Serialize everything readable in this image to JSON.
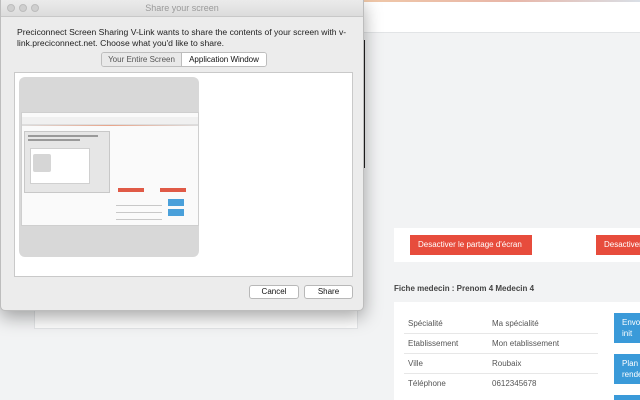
{
  "dialog": {
    "title": "Share your screen",
    "message": "Preciconnect Screen Sharing V-Link wants to share the contents of your screen with v-link.preciconnect.net. Choose what you'd like to share.",
    "tabs": [
      {
        "label": "Your Entire Screen",
        "selected": false
      },
      {
        "label": "Application Window",
        "selected": true
      }
    ],
    "cancel_label": "Cancel",
    "share_label": "Share"
  },
  "page": {
    "actions": {
      "stop_sharing_label": "Desactiver le partage d'écran",
      "stop_sharing_label_2": "Desactiver"
    },
    "fiche": {
      "title": "Fiche medecin : Prenom 4 Medecin 4",
      "rows": [
        {
          "label": "Spécialité",
          "value": "Ma spécialité"
        },
        {
          "label": "Etablissement",
          "value": "Mon etablissement"
        },
        {
          "label": "Ville",
          "value": "Roubaix"
        },
        {
          "label": "Téléphone",
          "value": "0612345678"
        }
      ],
      "buttons": [
        "Envo\ninit",
        "Plan\nrende"
      ]
    }
  },
  "colors": {
    "danger": "#e74c3c",
    "primary": "#3a9ad9"
  }
}
